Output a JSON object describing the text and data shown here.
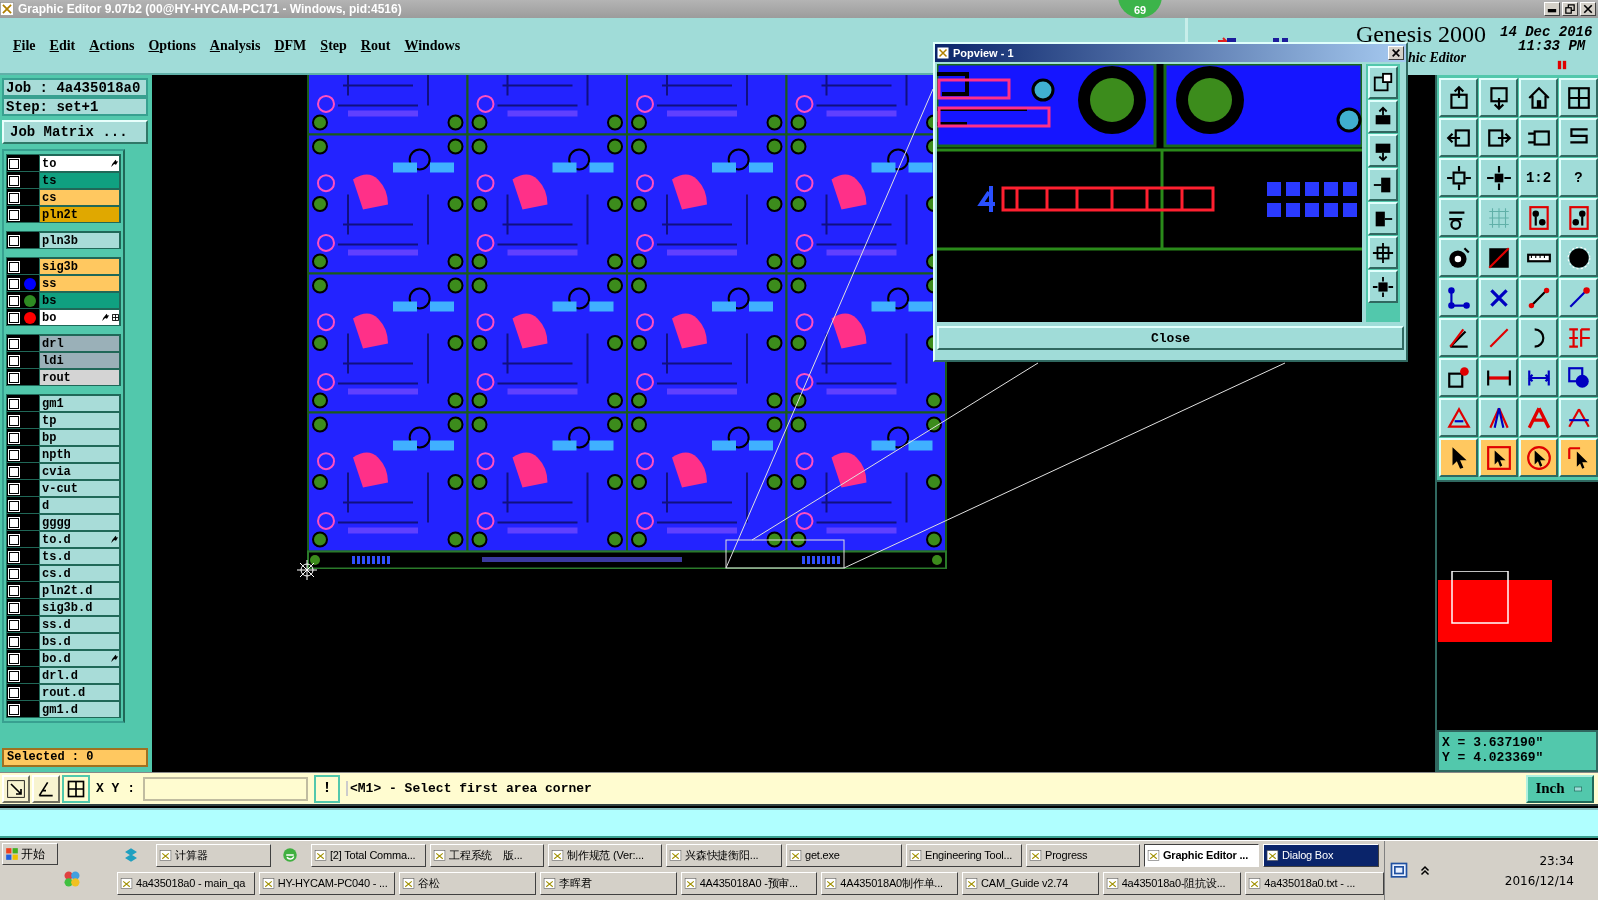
{
  "window": {
    "title": "Graphic Editor 9.07b2 (00@HY-HYCAM-PC171 - Windows, pid:4516)",
    "badge": "69"
  },
  "menu": [
    "File",
    "Edit",
    "Actions",
    "Options",
    "Analysis",
    "DFM",
    "Step",
    "Rout",
    "Windows"
  ],
  "header": {
    "product": "Genesis 2000",
    "subtitle": "hic Editor",
    "date": "14 Dec 2016",
    "time": "11:33 PM"
  },
  "job": {
    "job": "Job : 4a435018a0",
    "step": "Step: set+1",
    "matrix_button": "Job Matrix ..."
  },
  "layer_groups": [
    [
      {
        "name": "to",
        "kind": "silk_screen",
        "checked": false,
        "affected": true,
        "features_shown": false
      },
      {
        "name": "ts",
        "kind": "solder_mask",
        "checked": false,
        "affected": false,
        "features_shown": false
      },
      {
        "name": "cs",
        "kind": "signal",
        "checked": false,
        "affected": false,
        "features_shown": false
      },
      {
        "name": "pln2t",
        "kind": "power_ground",
        "checked": false,
        "affected": false,
        "features_shown": false
      }
    ],
    [
      {
        "name": "pln3b",
        "kind": "document",
        "checked": false,
        "affected": false,
        "features_shown": false
      }
    ],
    [
      {
        "name": "sig3b",
        "kind": "signal",
        "checked": false,
        "affected": false,
        "features_shown": false
      },
      {
        "name": "ss",
        "kind": "signal",
        "color": "#0000ff",
        "checked": false,
        "affected": false,
        "features_shown": false
      },
      {
        "name": "bs",
        "kind": "solder_mask",
        "color": "#2e8b22",
        "checked": false,
        "affected": false,
        "features_shown": false
      },
      {
        "name": "bo",
        "kind": "silk_screen",
        "color": "#ff0000",
        "checked": false,
        "affected": true,
        "features_shown": true
      }
    ],
    [
      {
        "name": "drl",
        "kind": "drill",
        "checked": false,
        "affected": false,
        "features_shown": false
      },
      {
        "name": "ldi",
        "kind": "drill",
        "checked": false,
        "affected": false,
        "features_shown": false
      },
      {
        "name": "rout",
        "kind": "rout",
        "checked": false,
        "affected": false,
        "features_shown": false
      }
    ],
    [
      {
        "name": "gm1",
        "kind": "document",
        "checked": false,
        "affected": false,
        "features_shown": false
      },
      {
        "name": "tp",
        "kind": "document",
        "checked": false,
        "affected": false,
        "features_shown": false
      },
      {
        "name": "bp",
        "kind": "document",
        "checked": false,
        "affected": false,
        "features_shown": false
      },
      {
        "name": "npth",
        "kind": "document",
        "checked": false,
        "affected": false,
        "features_shown": false
      },
      {
        "name": "cvia",
        "kind": "document",
        "checked": false,
        "affected": false,
        "features_shown": false
      },
      {
        "name": "v-cut",
        "kind": "document",
        "checked": false,
        "affected": false,
        "features_shown": false
      },
      {
        "name": "d",
        "kind": "document",
        "checked": false,
        "affected": false,
        "features_shown": false
      },
      {
        "name": "gggg",
        "kind": "document",
        "checked": false,
        "affected": false,
        "features_shown": false
      },
      {
        "name": "to.d",
        "kind": "document",
        "checked": false,
        "affected": true,
        "features_shown": false
      },
      {
        "name": "ts.d",
        "kind": "document",
        "checked": false,
        "affected": false,
        "features_shown": false
      },
      {
        "name": "cs.d",
        "kind": "document",
        "checked": false,
        "affected": false,
        "features_shown": false
      },
      {
        "name": "pln2t.d",
        "kind": "document",
        "checked": false,
        "affected": false,
        "features_shown": false
      },
      {
        "name": "sig3b.d",
        "kind": "document",
        "checked": false,
        "affected": false,
        "features_shown": false
      },
      {
        "name": "ss.d",
        "kind": "document",
        "checked": false,
        "affected": false,
        "features_shown": false
      },
      {
        "name": "bs.d",
        "kind": "document",
        "checked": false,
        "affected": false,
        "features_shown": false
      },
      {
        "name": "bo.d",
        "kind": "document",
        "checked": false,
        "affected": true,
        "features_shown": false
      },
      {
        "name": "drl.d",
        "kind": "document",
        "checked": false,
        "affected": false,
        "features_shown": false
      },
      {
        "name": "rout.d",
        "kind": "document",
        "checked": false,
        "affected": false,
        "features_shown": false
      },
      {
        "name": "gm1.d",
        "kind": "document",
        "checked": false,
        "affected": false,
        "features_shown": false
      }
    ]
  ],
  "selected_count": "Selected : 0",
  "popview": {
    "title": "Popview - 1",
    "close_button": "Close"
  },
  "tool_palette": {
    "ratio_button": "1:2",
    "help_button": "?"
  },
  "coordinates": {
    "x": "X = 3.637190\"",
    "y": "Y = 4.023369\""
  },
  "command_bar": {
    "xy_label": "X Y :",
    "alert_button": "!",
    "message": "<M1> - Select first area corner",
    "units": "Inch"
  },
  "taskbar": {
    "start": "开始",
    "top_row": [
      {
        "label": "计算器",
        "selected": false,
        "highlighted": false
      },
      {
        "label": "[2] Total Comma...",
        "selected": false,
        "highlighted": false
      },
      {
        "label": "工程系统　版...",
        "selected": false,
        "highlighted": false
      },
      {
        "label": "制作规范 (Ver:...",
        "selected": false,
        "highlighted": false
      },
      {
        "label": "兴森快捷衡阳...",
        "selected": false,
        "highlighted": false
      },
      {
        "label": "get.exe",
        "selected": false,
        "highlighted": false
      },
      {
        "label": "Engineering Tool...",
        "selected": false,
        "highlighted": false
      },
      {
        "label": "Progress",
        "selected": false,
        "highlighted": false
      },
      {
        "label": "Graphic Editor ...",
        "selected": true,
        "highlighted": false
      },
      {
        "label": "Dialog Box",
        "selected": false,
        "highlighted": true
      }
    ],
    "bottom_row": [
      {
        "label": "4a435018a0 - main_qa",
        "selected": false,
        "highlighted": false
      },
      {
        "label": "HY-HYCAM-PC040 - ...",
        "selected": false,
        "highlighted": false
      },
      {
        "label": "谷松",
        "selected": false,
        "highlighted": false
      },
      {
        "label": "李晖君",
        "selected": false,
        "highlighted": false
      },
      {
        "label": "4A435018A0 -预审...",
        "selected": false,
        "highlighted": false
      },
      {
        "label": "4A435018A0制作单...",
        "selected": false,
        "highlighted": false
      },
      {
        "label": "CAM_Guide v2.74",
        "selected": false,
        "highlighted": false
      },
      {
        "label": "4a435018a0-阻抗设...",
        "selected": false,
        "highlighted": false
      },
      {
        "label": "4a435018a0.txt - ...",
        "selected": false,
        "highlighted": false
      }
    ],
    "time": "23:34",
    "date": "2016/12/14"
  }
}
